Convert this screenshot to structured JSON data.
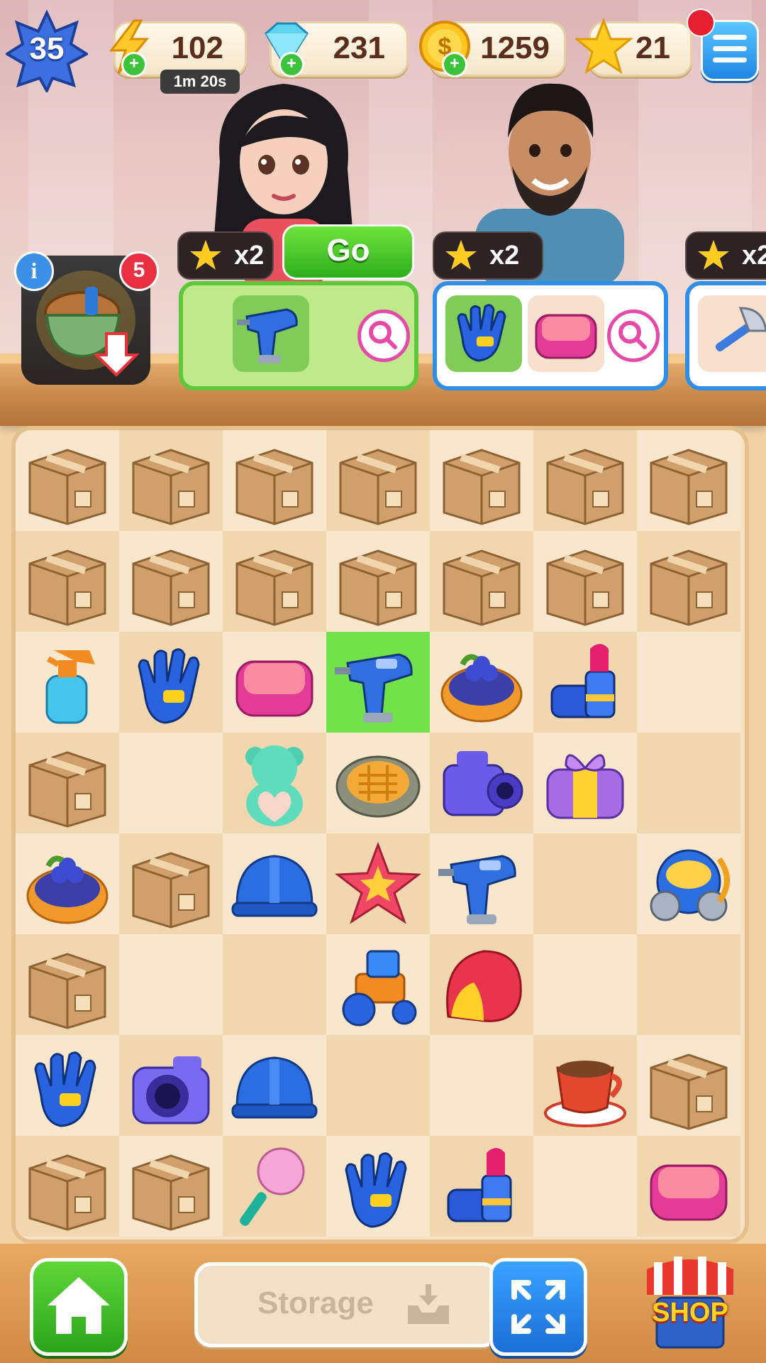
{
  "hud": {
    "level": "35",
    "energy": {
      "value": "102",
      "timer": "1m 20s"
    },
    "gems": {
      "value": "231"
    },
    "coins": {
      "value": "1259"
    },
    "stars": {
      "value": "21"
    }
  },
  "special_item": {
    "info": "i",
    "count": "5"
  },
  "orders": [
    {
      "reward": "x2",
      "button": "Go",
      "items": [
        "drill"
      ]
    },
    {
      "reward": "x2",
      "items": [
        "glove",
        "compact"
      ]
    },
    {
      "reward": "x2",
      "items": [
        "axe"
      ]
    }
  ],
  "board": {
    "rows": [
      [
        "box",
        "box",
        "box",
        "box",
        "box",
        "box",
        "box"
      ],
      [
        "box",
        "box",
        "box",
        "box",
        "box",
        "box",
        "box"
      ],
      [
        "spray-bottle",
        "glove",
        "compact",
        "drill",
        "blueberry-pie",
        "lipstick",
        ""
      ],
      [
        "box",
        "",
        "teddy-bear",
        "pie-crust",
        "video-camera",
        "gift",
        ""
      ],
      [
        "blueberry-pie",
        "box",
        "hard-hat",
        "starfish",
        "drill",
        "",
        "gas-mask"
      ],
      [
        "box",
        "",
        "",
        "toy-tractor",
        "shell",
        "",
        ""
      ],
      [
        "glove",
        "camera",
        "hard-hat",
        "",
        "",
        "coffee-cup",
        "box"
      ],
      [
        "box",
        "box",
        "feather-duster",
        "glove",
        "lipstick",
        "",
        "compact"
      ]
    ],
    "highlight": [
      2,
      3
    ]
  },
  "bottom": {
    "storage_label": "Storage",
    "shop_label": "SHOP"
  }
}
